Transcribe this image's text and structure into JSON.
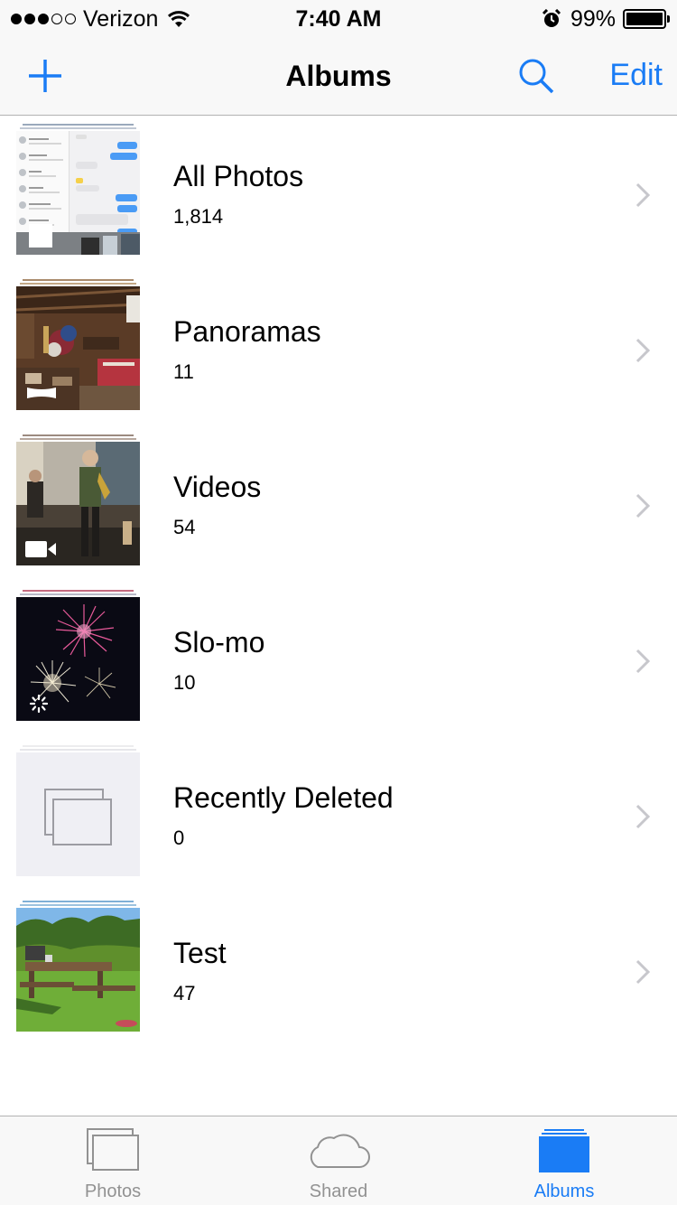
{
  "status_bar": {
    "signal_filled": 3,
    "signal_total": 5,
    "carrier": "Verizon",
    "wifi_icon": "wifi-icon",
    "time": "7:40 AM",
    "alarm_icon": "alarm-clock-icon",
    "battery_text": "99%",
    "battery_level": 0.99
  },
  "nav": {
    "add_icon": "plus-icon",
    "title": "Albums",
    "search_icon": "search-icon",
    "edit_label": "Edit"
  },
  "albums": [
    {
      "name": "All Photos",
      "count": "1,814",
      "badge_icon": "none"
    },
    {
      "name": "Panoramas",
      "count": "11",
      "badge_icon": "panorama-icon"
    },
    {
      "name": "Videos",
      "count": "54",
      "badge_icon": "video-camera-icon"
    },
    {
      "name": "Slo-mo",
      "count": "10",
      "badge_icon": "slo-mo-icon"
    },
    {
      "name": "Recently Deleted",
      "count": "0",
      "badge_icon": "empty-album-icon"
    },
    {
      "name": "Test",
      "count": "47",
      "badge_icon": "none"
    }
  ],
  "tabs": [
    {
      "label": "Photos",
      "icon": "photos-tab-icon",
      "active": false
    },
    {
      "label": "Shared",
      "icon": "cloud-icon",
      "active": false
    },
    {
      "label": "Albums",
      "icon": "albums-tab-icon",
      "active": true
    }
  ],
  "colors": {
    "accent": "#1a7cf5",
    "inactive": "#929292",
    "bar_background": "#f8f8f8",
    "chevron": "#c7c7cc"
  }
}
